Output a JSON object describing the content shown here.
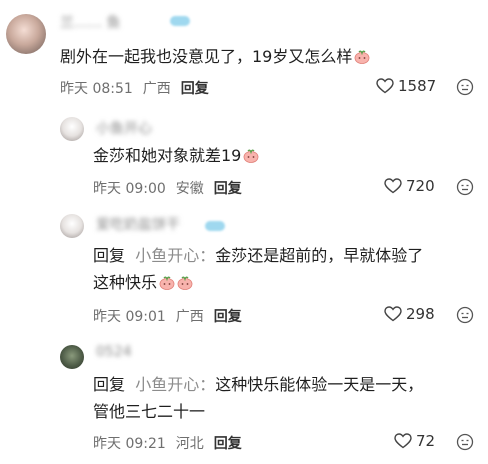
{
  "comments": [
    {
      "username": "兰…… 鱼",
      "text": "剧外在一起我也没意见了，19岁又怎么样",
      "emoji": "peach-emoji",
      "time": "昨天 08:51",
      "location": "广西",
      "reply_label": "回复",
      "likes": "1587"
    },
    {
      "username": "小鱼开心",
      "text": "金莎和她对象就差19",
      "emoji": "peach-emoji",
      "time": "昨天 09:00",
      "location": "安徽",
      "reply_label": "回复",
      "likes": "720"
    },
    {
      "username": "爱吃奶盐饼干",
      "reply_prefix": "回复",
      "reply_to": "小鱼开心：",
      "text_line1": "金莎还是超前的，早就体验了",
      "text_line2": "这种快乐",
      "time": "昨天 09:01",
      "location": "广西",
      "reply_label": "回复",
      "likes": "298"
    },
    {
      "username": "0524",
      "reply_prefix": "回复",
      "reply_to": "小鱼开心：",
      "text_line1": "这种快乐能体验一天是一天，",
      "text_line2": "管他三七二十一",
      "time": "昨天 09:21",
      "location": "河北",
      "reply_label": "回复",
      "likes": "72"
    }
  ],
  "colors": {
    "secondary_text": "#8c8c8c",
    "meta_text": "#6f6f6f",
    "peach": "#f7a7a3"
  },
  "icons": {
    "like": "heart-outline-icon",
    "more": "more-face-icon"
  }
}
